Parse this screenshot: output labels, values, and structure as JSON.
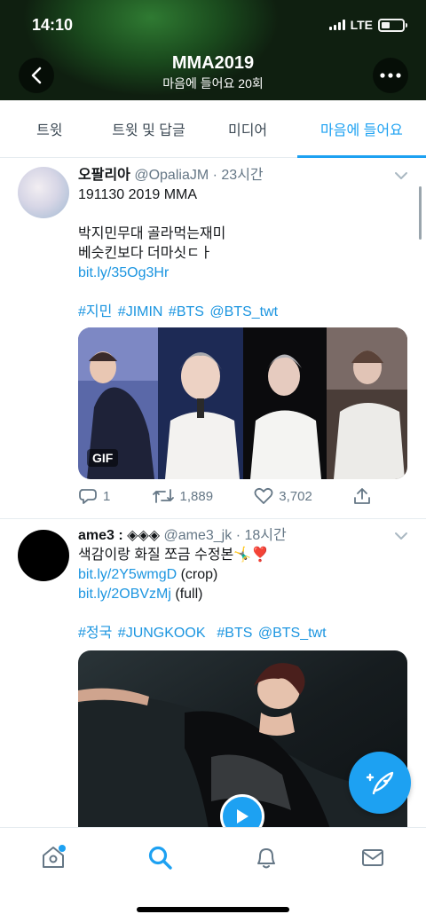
{
  "status": {
    "time": "14:10",
    "network": "LTE"
  },
  "header": {
    "title": "MMA2019",
    "subtitle": "마음에 들어요 20회"
  },
  "tabs": [
    {
      "label": "트윗"
    },
    {
      "label": "트윗 및 답글"
    },
    {
      "label": "미디어"
    },
    {
      "label": "마음에 들어요",
      "active": true
    }
  ],
  "tweets": [
    {
      "name": "오팔리아",
      "handle": "@OpaliaJM",
      "time": "· 23시간",
      "line1": "191130 2019 MMA",
      "line2": "박지민무대 골라먹는재미",
      "line3": "베슷킨보다 더마싯ㄷㅏ",
      "link": "bit.ly/35Og3Hr",
      "tags": [
        "#지민",
        "#JIMIN",
        "#BTS",
        "@BTS_twt"
      ],
      "media_badge": "GIF",
      "replies": "1",
      "retweets": "1,889",
      "likes": "3,702"
    },
    {
      "name": "ame3 : ◈◈◈",
      "handle": "@ame3_jk",
      "time": "· 18시간",
      "line1": "색감이랑 화질 쪼금 수정본🤸‍♂️❣️",
      "link1": "bit.ly/2Y5wmgD",
      "link1_note": " (crop)",
      "link2": "bit.ly/2OBVzMj",
      "link2_note": " (full)",
      "tags": [
        "#정국",
        "#JUNGKOOK",
        "#BTS",
        "@BTS_twt"
      ]
    }
  ],
  "icons": {
    "back": "chevron-left-icon",
    "more": "more-dots-icon",
    "reply": "reply-icon",
    "retweet": "retweet-icon",
    "like": "heart-icon",
    "share": "share-icon",
    "compose": "compose-feather-icon",
    "home": "home-icon",
    "search": "search-icon",
    "notifications": "bell-icon",
    "messages": "mail-icon"
  },
  "colors": {
    "accent": "#1da1f2",
    "link": "#1b95e0",
    "muted": "#657786"
  }
}
